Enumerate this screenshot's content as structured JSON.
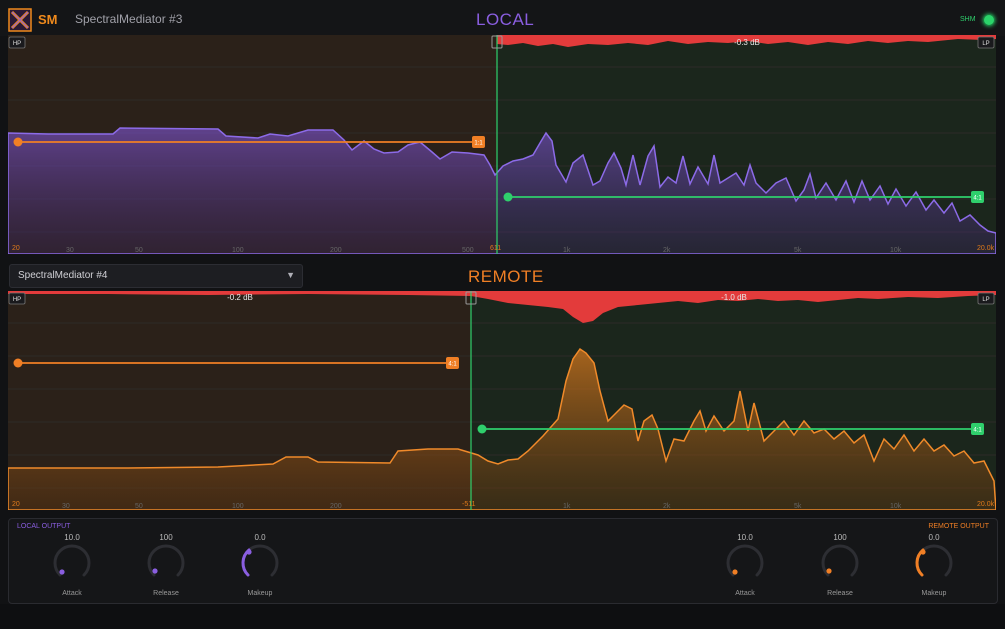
{
  "header": {
    "brand": "SM",
    "instance_name": "SpectralMediator #3",
    "local_title": "LOCAL",
    "shm_label": "SHM",
    "logo_icon": "x-logo-icon",
    "shm_status_color": "#2bd46a"
  },
  "colors": {
    "local_accent": "#8a5ee0",
    "remote_accent": "#f07f25",
    "green": "#2fcf6c",
    "red": "#e33b3b",
    "orange_band": "#f07f25"
  },
  "freq_axis": {
    "ticks": [
      "30",
      "50",
      "100",
      "200",
      "500",
      "1k",
      "2k",
      "5k",
      "10k"
    ],
    "min_label": "20",
    "max_label": "20.0k"
  },
  "local": {
    "hp_tag": "HP",
    "lp_tag": "LP",
    "split_freq": "611",
    "gain_reduction": "-0.3 dB",
    "low_band_ratio": "1:1",
    "high_band_ratio": "4:1"
  },
  "remote": {
    "source_select": "SpectralMediator #4",
    "title": "REMOTE",
    "hp_tag": "HP",
    "lp_tag": "LP",
    "split_freq": "-511",
    "low_gain_reduction": "-0.2 dB",
    "high_gain_reduction": "-1.0 dB",
    "low_band_ratio": "4:1",
    "high_band_ratio": "4:1"
  },
  "local_output": {
    "label": "LOCAL OUTPUT",
    "knobs": [
      {
        "name": "Attack",
        "value": "10.0"
      },
      {
        "name": "Release",
        "value": "100"
      },
      {
        "name": "Makeup",
        "value": "0.0"
      }
    ]
  },
  "remote_output": {
    "label": "REMOTE OUTPUT",
    "knobs": [
      {
        "name": "Attack",
        "value": "10.0"
      },
      {
        "name": "Release",
        "value": "100"
      },
      {
        "name": "Makeup",
        "value": "0.0"
      }
    ]
  }
}
